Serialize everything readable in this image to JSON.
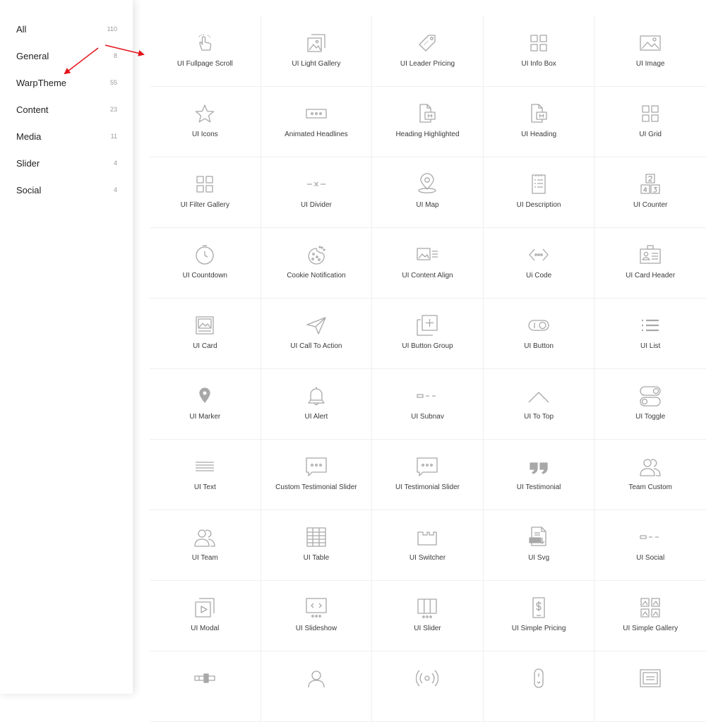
{
  "categories": [
    {
      "label": "All",
      "count": "110"
    },
    {
      "label": "General",
      "count": "8"
    },
    {
      "label": "WarpTheme",
      "count": "55"
    },
    {
      "label": "Content",
      "count": "23"
    },
    {
      "label": "Media",
      "count": "11"
    },
    {
      "label": "Slider",
      "count": "4"
    },
    {
      "label": "Social",
      "count": "4"
    }
  ],
  "elements": [
    {
      "label": "UI Fullpage Scroll",
      "icon": "hand-swipe-icon"
    },
    {
      "label": "UI Light Gallery",
      "icon": "gallery-icon"
    },
    {
      "label": "UI Leader Pricing",
      "icon": "price-tag-icon"
    },
    {
      "label": "UI Info Box",
      "icon": "grid-icon"
    },
    {
      "label": "UI Image",
      "icon": "image-icon"
    },
    {
      "label": "UI Icons",
      "icon": "star-icon"
    },
    {
      "label": "Animated Headlines",
      "icon": "dots-box-icon"
    },
    {
      "label": "Heading Highlighted",
      "icon": "heading-doc-icon"
    },
    {
      "label": "UI Heading",
      "icon": "heading-doc-icon"
    },
    {
      "label": "UI Grid",
      "icon": "grid-icon"
    },
    {
      "label": "UI Filter Gallery",
      "icon": "grid-icon"
    },
    {
      "label": "UI Divider",
      "icon": "divider-icon"
    },
    {
      "label": "UI Map",
      "icon": "map-pin-icon"
    },
    {
      "label": "UI Description",
      "icon": "description-list-icon"
    },
    {
      "label": "UI Counter",
      "icon": "counter-icon"
    },
    {
      "label": "UI Countdown",
      "icon": "clock-icon"
    },
    {
      "label": "Cookie Notification",
      "icon": "cookie-icon"
    },
    {
      "label": "UI Content Align",
      "icon": "content-align-icon"
    },
    {
      "label": "Ui Code",
      "icon": "code-icon"
    },
    {
      "label": "UI Card Header",
      "icon": "id-card-icon"
    },
    {
      "label": "UI Card",
      "icon": "card-icon"
    },
    {
      "label": "UI Call To Action",
      "icon": "paper-plane-icon"
    },
    {
      "label": "UI Button Group",
      "icon": "button-group-icon"
    },
    {
      "label": "UI Button",
      "icon": "toggle-button-icon"
    },
    {
      "label": "UI List",
      "icon": "list-icon"
    },
    {
      "label": "UI Marker",
      "icon": "marker-icon"
    },
    {
      "label": "UI Alert",
      "icon": "bell-icon"
    },
    {
      "label": "UI Subnav",
      "icon": "subnav-icon"
    },
    {
      "label": "UI To Top",
      "icon": "chevron-up-icon"
    },
    {
      "label": "UI Toggle",
      "icon": "toggle-switch-icon"
    },
    {
      "label": "UI Text",
      "icon": "text-lines-icon"
    },
    {
      "label": "Custom Testimonial Slider",
      "icon": "speech-bubble-icon"
    },
    {
      "label": "UI Testimonial Slider",
      "icon": "speech-bubble-icon"
    },
    {
      "label": "UI Testimonial",
      "icon": "quote-icon"
    },
    {
      "label": "Team Custom",
      "icon": "users-icon"
    },
    {
      "label": "UI Team",
      "icon": "users-icon"
    },
    {
      "label": "UI Table",
      "icon": "table-icon"
    },
    {
      "label": "UI Switcher",
      "icon": "switcher-icon"
    },
    {
      "label": "UI Svg",
      "icon": "svg-file-icon"
    },
    {
      "label": "UI Social",
      "icon": "subnav-icon"
    },
    {
      "label": "UI Modal",
      "icon": "modal-icon"
    },
    {
      "label": "UI Slideshow",
      "icon": "slideshow-icon"
    },
    {
      "label": "UI Slider",
      "icon": "slider-columns-icon"
    },
    {
      "label": "UI Simple Pricing",
      "icon": "pricing-doc-icon"
    },
    {
      "label": "UI Simple Gallery",
      "icon": "simple-gallery-icon"
    },
    {
      "label": "",
      "icon": "range-slider-icon"
    },
    {
      "label": "",
      "icon": "user-icon"
    },
    {
      "label": "",
      "icon": "broadcast-icon"
    },
    {
      "label": "",
      "icon": "scroll-mouse-icon"
    },
    {
      "label": "",
      "icon": "framed-panel-icon"
    }
  ],
  "colors": {
    "icon": "#a8a8a8",
    "text": "#222222",
    "count": "#9a9a9a",
    "divider": "#efefef",
    "annotation": "#e3141b"
  }
}
